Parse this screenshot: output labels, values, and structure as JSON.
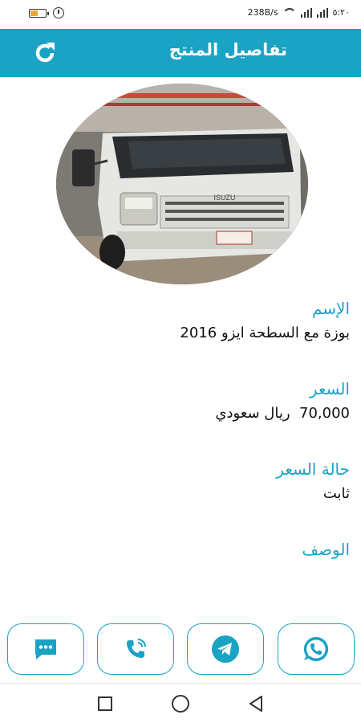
{
  "status_bar": {
    "net_speed": "238B/s",
    "time": "٥:٢٠"
  },
  "app_bar": {
    "title": "تفاصيل المنتج",
    "refresh_icon": "refresh-icon"
  },
  "product": {
    "image_icon": "truck-photo",
    "name_label": "الإسم",
    "name_value": "بوزة مع السطحة ايزو 2016",
    "price_label": "السعر",
    "price_value": "70,000  ريال سعودي",
    "price_status_label": "حالة السعر",
    "price_status_value": "ثابت",
    "description_label": "الوصف",
    "description_value": ""
  },
  "actions": [
    {
      "icon": "chat-icon"
    },
    {
      "icon": "phone-icon"
    },
    {
      "icon": "telegram-icon"
    },
    {
      "icon": "whatsapp-icon"
    }
  ],
  "colors": {
    "accent": "#1aa3c4"
  }
}
